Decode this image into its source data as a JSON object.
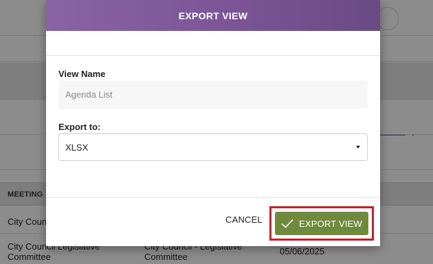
{
  "modal": {
    "title": "EXPORT VIEW",
    "view_name_label": "View Name",
    "view_name_placeholder": "Agenda List",
    "view_name_value": "",
    "export_to_label": "Export to:",
    "export_to_value": "XLSX",
    "cancel_label": "CANCEL",
    "export_label": "EXPORT VIEW"
  },
  "background": {
    "table_header": "MEETING",
    "rows": [
      {
        "cell1": "City Council"
      },
      {
        "cell1": "City Council Legislative Committee",
        "cell2": "City Council - Legislative Committee",
        "cell3": "05/06/2025"
      }
    ]
  },
  "icons": {
    "check": "check-icon",
    "caret": "caret-down-icon",
    "refresh": "refresh-icon"
  },
  "colors": {
    "header_purple": "#7b5595",
    "export_green": "#6f8a3c",
    "highlight_red": "#c01f2e"
  }
}
